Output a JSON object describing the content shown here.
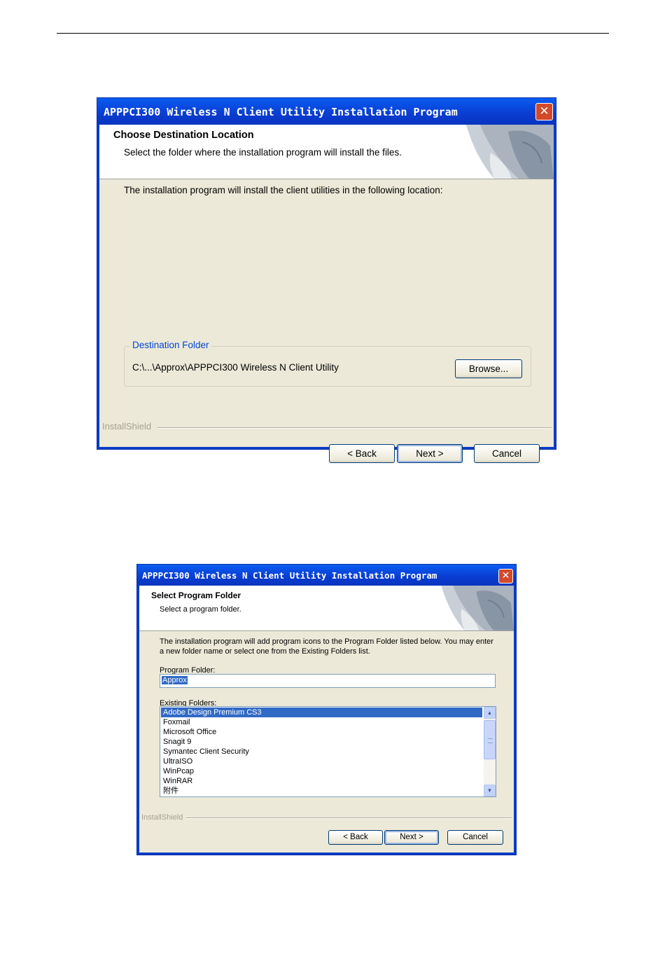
{
  "dialog1": {
    "title": "APPPCI300 Wireless N Client Utility Installation Program",
    "close": "✕",
    "header_title": "Choose Destination Location",
    "header_subtitle": "Select the folder where the installation program will install the files.",
    "body_text": "The installation program will install the client utilities in the following location:",
    "group_label": "Destination Folder",
    "destination_path": "C:\\...\\Approx\\APPPCI300 Wireless N Client Utility",
    "browse_label": "Browse...",
    "installshield": "InstallShield",
    "back_label": "< Back",
    "next_label": "Next >",
    "cancel_label": "Cancel"
  },
  "dialog2": {
    "title": "APPPCI300 Wireless N Client Utility Installation Program",
    "close": "✕",
    "header_title": "Select Program Folder",
    "header_subtitle": "Select a program folder.",
    "body_text": "The installation program will add program icons to the Program Folder listed below. You may enter a new folder name or select one from the Existing Folders list.",
    "program_folder_label": "Program Folder:",
    "program_folder_value": "Approx",
    "existing_folders_label": "Existing Folders:",
    "folders": [
      "Adobe Design Premium CS3",
      "Foxmail",
      "Microsoft Office",
      "Snagit 9",
      "Symantec Client Security",
      "UltraISO",
      "WinPcap",
      "WinRAR",
      "附件"
    ],
    "selected_folder": "Adobe Design Premium CS3",
    "installshield": "InstallShield",
    "back_label": "< Back",
    "next_label": "Next >",
    "cancel_label": "Cancel"
  },
  "colors": {
    "titlebar": "#0a3cd0",
    "selection": "#316ac5",
    "dialog_bg": "#ece9d8",
    "group_label": "#0046d5"
  },
  "icons": {
    "close": "close-icon",
    "scroll_up": "scroll-up-icon",
    "scroll_down": "scroll-down-icon"
  }
}
